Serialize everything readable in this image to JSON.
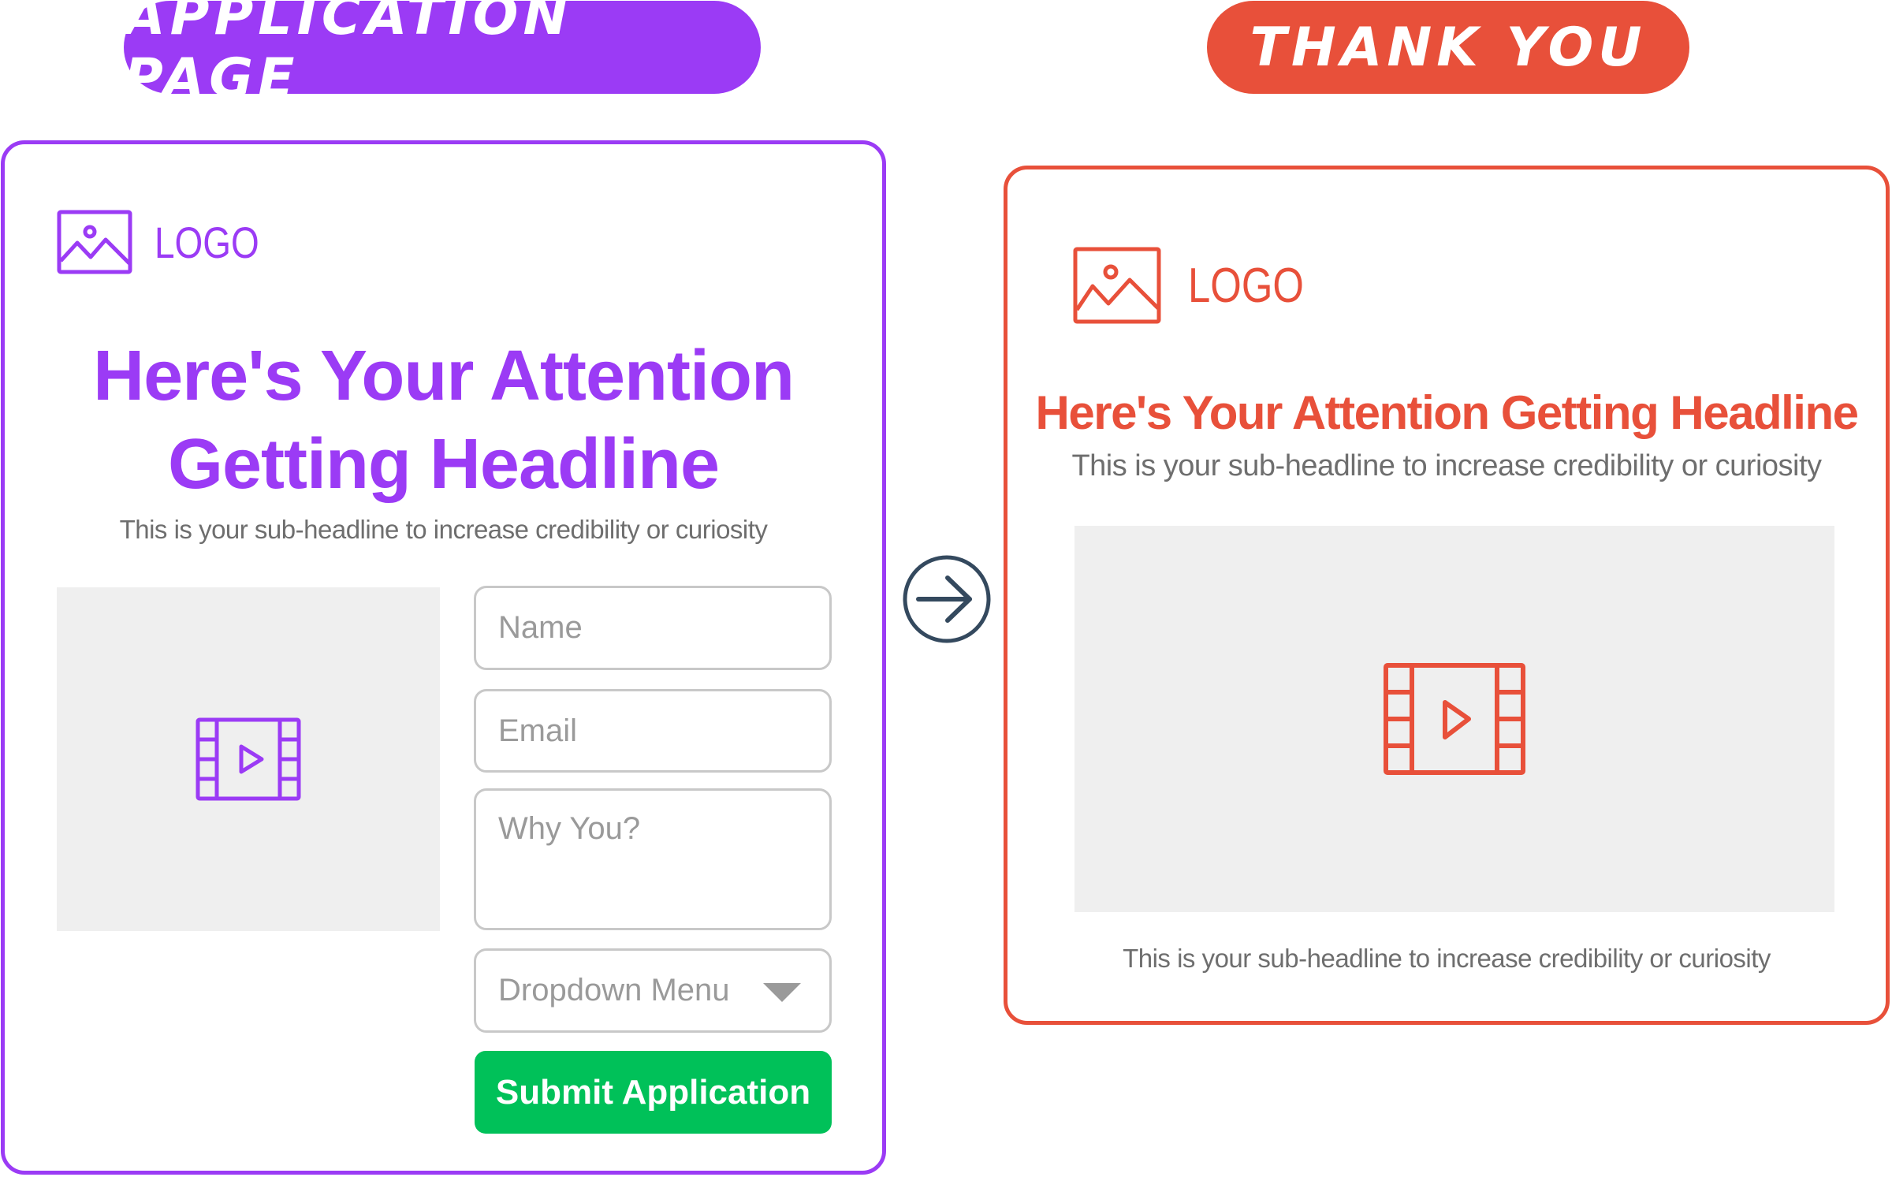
{
  "labels": {
    "application_page": "APPLICATION PAGE",
    "thank_you": "THANK YOU"
  },
  "colors": {
    "purple": "#9b3bf5",
    "red": "#e8503a",
    "green": "#00c159",
    "arrow": "#34495e",
    "placeholder_gray": "#efefef"
  },
  "application_page": {
    "logo_text": "LOGO",
    "logo_icon": "image-icon",
    "headline_line1": "Here's Your Attention",
    "headline_line2": "Getting Headline",
    "subheadline": "This is your sub-headline to increase credibility or curiosity",
    "video_icon": "video-film-icon",
    "form": {
      "name_placeholder": "Name",
      "email_placeholder": "Email",
      "why_placeholder": "Why You?",
      "dropdown_value": "Dropdown Menu",
      "submit_label": "Submit Application"
    }
  },
  "flow_arrow_icon": "arrow-right-circle-icon",
  "thank_you_page": {
    "logo_text": "LOGO",
    "logo_icon": "image-icon",
    "headline": "Here's Your Attention Getting Headline",
    "subheadline_top": "This is your sub-headline to increase credibility or curiosity",
    "video_icon": "video-film-icon",
    "subheadline_bottom": "This is your sub-headline to increase credibility or curiosity"
  }
}
